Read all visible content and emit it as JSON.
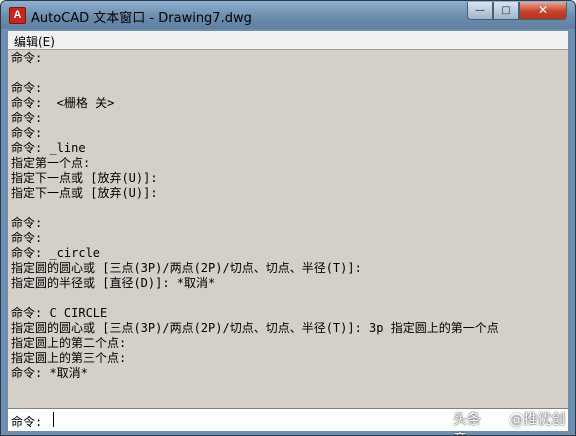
{
  "window": {
    "title": "AutoCAD 文本窗口 - Drawing7.dwg",
    "icon": "autocad-app-icon",
    "controls": {
      "minimize": "—",
      "maximize": "□",
      "close": "✕"
    }
  },
  "menu": {
    "items": [
      {
        "label": "编辑(E)"
      }
    ]
  },
  "history": [
    "命令:",
    "",
    "命令:",
    "命令:  <栅格 关>",
    "命令:",
    "命令:",
    "命令: _line",
    "指定第一个点:",
    "指定下一点或 [放弃(U)]:",
    "指定下一点或 [放弃(U)]:",
    "",
    "命令:",
    "命令:",
    "命令: _circle",
    "指定圆的圆心或 [三点(3P)/两点(2P)/切点、切点、半径(T)]:",
    "指定圆的半径或 [直径(D)]: *取消*",
    "",
    "命令: C CIRCLE",
    "指定圆的圆心或 [三点(3P)/两点(2P)/切点、切点、半径(T)]: 3p 指定圆上的第一个点",
    "指定圆上的第二个点:",
    "指定圆上的第三个点:",
    "命令: *取消*"
  ],
  "command_line": {
    "prompt": "命令:",
    "value": ""
  },
  "watermark": {
    "left_text": "头条",
    "right_text": "@推优创意"
  }
}
